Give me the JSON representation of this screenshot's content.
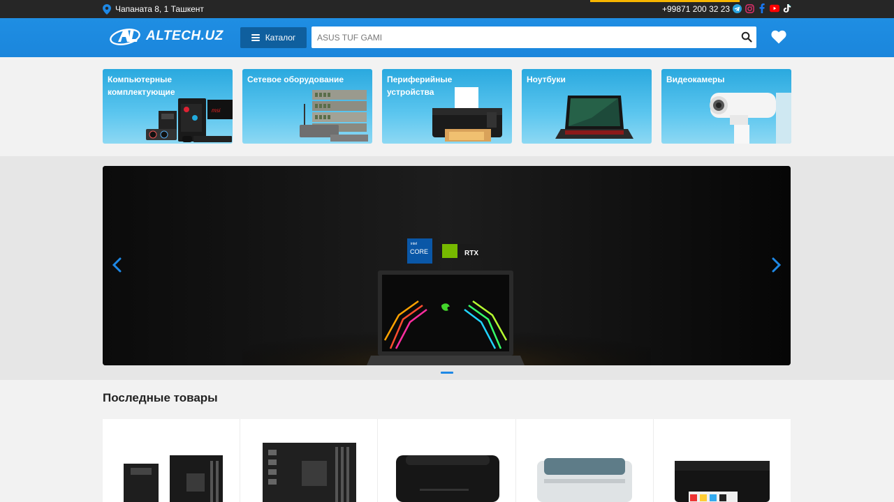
{
  "topbar": {
    "address": "Чапаната 8, 1 Ташкент",
    "phone": "+99871 200 32 23",
    "socials": [
      "telegram-icon",
      "instagram-icon",
      "facebook-icon",
      "youtube-icon",
      "tiktok-icon"
    ]
  },
  "header": {
    "logo_text": "ALTECH.UZ",
    "catalog_label": "Каталог",
    "search_value": "ASUS TUF GAMI",
    "colors": {
      "primary": "#1e88e5",
      "dark": "#262626",
      "catalog": "#0f5f9e"
    }
  },
  "categories": [
    {
      "label": "Компьютерные комплектующие"
    },
    {
      "label": "Сетевое оборудование"
    },
    {
      "label": "Периферийные устройства"
    },
    {
      "label": "Ноутбуки"
    },
    {
      "label": "Видеокамеры"
    }
  ],
  "banner": {
    "badges": [
      "intel core i9",
      "GeForce RTX"
    ],
    "active_slide": 1
  },
  "latest": {
    "title": "Последные товары",
    "products": [
      "motherboard",
      "motherboard",
      "laser-printer",
      "laser-printer",
      "inkjet-printer"
    ]
  }
}
